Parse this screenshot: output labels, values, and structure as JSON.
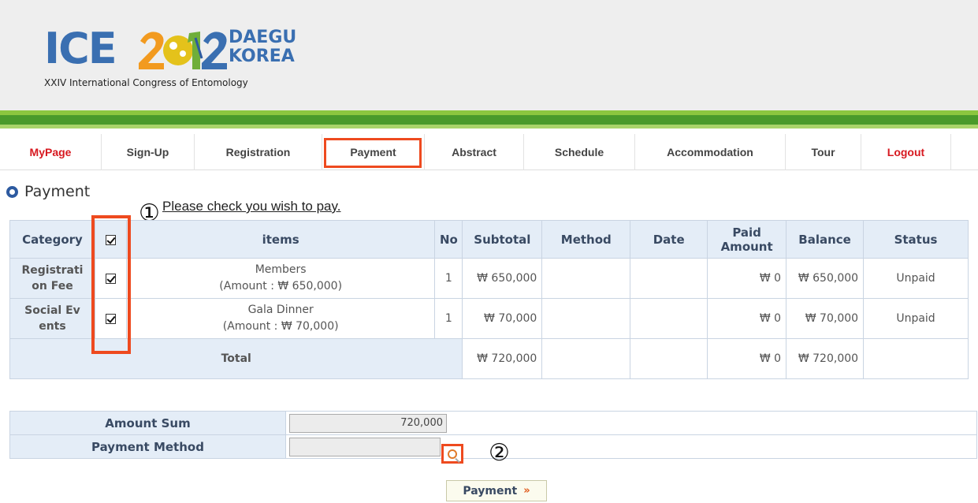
{
  "logo": {
    "ice": "ICE",
    "city_line1": "DAEGU",
    "city_line2": "KOREA",
    "subtitle": "XXIV International Congress of Entomology"
  },
  "nav": {
    "items": [
      {
        "label": "MyPage",
        "color": "#d71920"
      },
      {
        "label": "Sign-Up"
      },
      {
        "label": "Registration"
      },
      {
        "label": "Payment"
      },
      {
        "label": "Abstract"
      },
      {
        "label": "Schedule"
      },
      {
        "label": "Accommodation"
      },
      {
        "label": "Tour"
      },
      {
        "label": "Logout",
        "color": "#d71920"
      }
    ]
  },
  "section_title": "Payment",
  "instruction": "Please check you wish to pay.",
  "markers": {
    "one": "①",
    "two": "②"
  },
  "table": {
    "headers": {
      "category": "Category",
      "items": "items",
      "no": "No",
      "subtotal": "Subtotal",
      "method": "Method",
      "date": "Date",
      "paid_amount_1": "Paid",
      "paid_amount_2": "Amount",
      "balance": "Balance",
      "status": "Status"
    },
    "rows": [
      {
        "category_1": "Registrati",
        "category_2": "on Fee",
        "item_name": "Members",
        "item_amount": "(Amount : ₩ 650,000)",
        "no": "1",
        "subtotal": "₩ 650,000",
        "method": "",
        "date": "",
        "paid": "₩ 0",
        "balance": "₩ 650,000",
        "status": "Unpaid"
      },
      {
        "category_1": "Social Ev",
        "category_2": "ents",
        "item_name": "Gala Dinner",
        "item_amount": "(Amount : ₩ 70,000)",
        "no": "1",
        "subtotal": "₩ 70,000",
        "method": "",
        "date": "",
        "paid": "₩ 0",
        "balance": "₩ 70,000",
        "status": "Unpaid"
      }
    ],
    "total": {
      "label": "Total",
      "subtotal": "₩ 720,000",
      "paid": "₩ 0",
      "balance": "₩ 720,000"
    }
  },
  "form": {
    "amount_sum_label": "Amount Sum",
    "amount_sum_value": "720,000",
    "payment_method_label": "Payment Method",
    "payment_method_value": ""
  },
  "payment_button": {
    "label": "Payment",
    "arrow": "»"
  },
  "colors": {
    "accent": "#ee4a1f",
    "header_blue": "#e4edf7",
    "brand_blue": "#3a6fb1",
    "green": "#4a9a2b"
  }
}
